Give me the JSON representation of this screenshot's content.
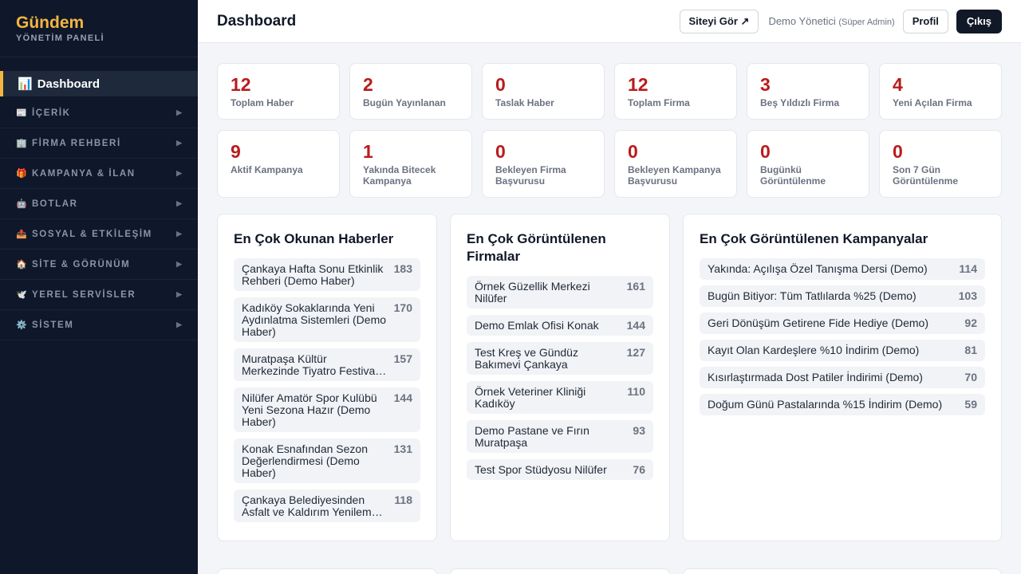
{
  "brand": {
    "title": "Gündem",
    "subtitle": "YÖNETİM PANELİ"
  },
  "sidebar": {
    "active": {
      "icon": "📊",
      "label": "Dashboard"
    },
    "items": [
      {
        "icon": "📰",
        "label": "İÇERİK"
      },
      {
        "icon": "🏢",
        "label": "FİRMA REHBERİ"
      },
      {
        "icon": "🎁",
        "label": "KAMPANYA & İLAN"
      },
      {
        "icon": "🤖",
        "label": "BOTLAR"
      },
      {
        "icon": "📤",
        "label": "SOSYAL & ETKİLEŞİM"
      },
      {
        "icon": "🏠",
        "label": "SİTE & GÖRÜNÜM"
      },
      {
        "icon": "🕊️",
        "label": "YEREL SERVİSLER"
      },
      {
        "icon": "⚙️",
        "label": "SİSTEM"
      }
    ],
    "arrow": "▶"
  },
  "header": {
    "title": "Dashboard",
    "view_site": "Siteyi Gör ↗",
    "user": "Demo Yönetici",
    "role": "(Süper Admin)",
    "profile": "Profil",
    "logout": "Çıkış"
  },
  "stats": [
    {
      "value": "12",
      "label": "Toplam Haber"
    },
    {
      "value": "2",
      "label": "Bugün Yayınlanan"
    },
    {
      "value": "0",
      "label": "Taslak Haber"
    },
    {
      "value": "12",
      "label": "Toplam Firma"
    },
    {
      "value": "3",
      "label": "Beş Yıldızlı Firma"
    },
    {
      "value": "4",
      "label": "Yeni Açılan Firma"
    },
    {
      "value": "9",
      "label": "Aktif Kampanya"
    },
    {
      "value": "1",
      "label": "Yakında Bitecek Kampanya"
    },
    {
      "value": "0",
      "label": "Bekleyen Firma Başvurusu"
    },
    {
      "value": "0",
      "label": "Bekleyen Kampanya Başvurusu"
    },
    {
      "value": "0",
      "label": "Bugünkü Görüntülenme"
    },
    {
      "value": "0",
      "label": "Son 7 Gün Görüntülenme"
    }
  ],
  "top_news": {
    "title": "En Çok Okunan Haberler",
    "items": [
      {
        "name": "Çankaya Hafta Sonu Etkinlik Rehberi (Demo Haber)",
        "count": "183"
      },
      {
        "name": "Kadıköy Sokaklarında Yeni Aydınlatma Sistemleri (Demo Haber)",
        "count": "170"
      },
      {
        "name": "Muratpaşa Kültür Merkezinde Tiyatro Festivali Başlıyor (Demo Haber)",
        "count": "157"
      },
      {
        "name": "Nilüfer Amatör Spor Kulübü Yeni Sezona Hazır (Demo Haber)",
        "count": "144"
      },
      {
        "name": "Konak Esnafından Sezon Değerlendirmesi (Demo Haber)",
        "count": "131"
      },
      {
        "name": "Çankaya Belediyesinden Asfalt ve Kaldırım Yenileme Çalışması (Demo Haber)",
        "count": "118"
      }
    ]
  },
  "top_firms": {
    "title": "En Çok Görüntülenen Firmalar",
    "items": [
      {
        "name": "Örnek Güzellik Merkezi Nilüfer",
        "count": "161"
      },
      {
        "name": "Demo Emlak Ofisi Konak",
        "count": "144"
      },
      {
        "name": "Test Kreş ve Gündüz Bakımevi Çankaya",
        "count": "127"
      },
      {
        "name": "Örnek Veteriner Kliniği Kadıköy",
        "count": "110"
      },
      {
        "name": "Demo Pastane ve Fırın Muratpaşa",
        "count": "93"
      },
      {
        "name": "Test Spor Stüdyosu Nilüfer",
        "count": "76"
      }
    ]
  },
  "top_campaigns": {
    "title": "En Çok Görüntülenen Kampanyalar",
    "items": [
      {
        "name": "Yakında: Açılışa Özel Tanışma Dersi (Demo)",
        "count": "114"
      },
      {
        "name": "Bugün Bitiyor: Tüm Tatlılarda %25 (Demo)",
        "count": "103"
      },
      {
        "name": "Geri Dönüşüm Getirene Fide Hediye (Demo)",
        "count": "92"
      },
      {
        "name": "Kayıt Olan Kardeşlere %10 İndirim (Demo)",
        "count": "81"
      },
      {
        "name": "Kısırlaştırmada Dost Patiler İndirimi (Demo)",
        "count": "70"
      },
      {
        "name": "Doğum Günü Pastalarında %15 İndirim (Demo)",
        "count": "59"
      }
    ]
  }
}
